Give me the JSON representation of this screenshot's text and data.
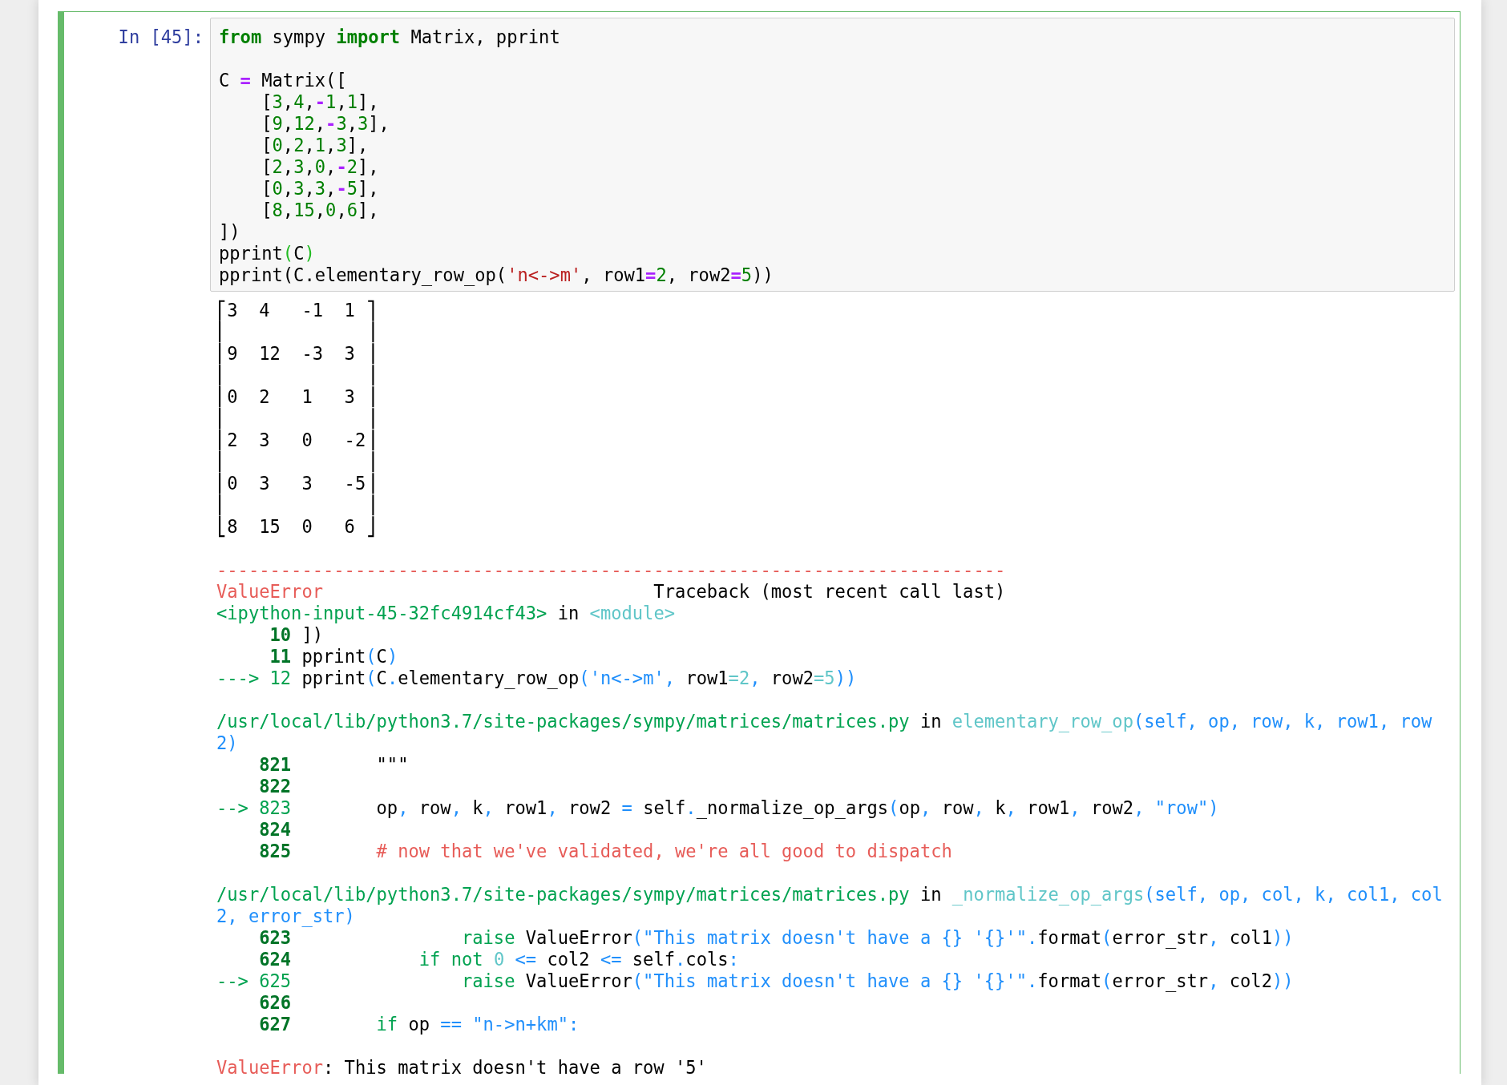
{
  "cell": {
    "prompt": "In [45]:",
    "selected": true,
    "input": [
      {
        "tokens": [
          {
            "text": "from",
            "kind": "kw"
          },
          {
            "text": " sympy ",
            "kind": "plain"
          },
          {
            "text": "import",
            "kind": "kw"
          },
          {
            "text": " Matrix, pprint",
            "kind": "plain"
          }
        ]
      },
      {
        "gap_before": true,
        "tokens": [
          {
            "text": "C ",
            "kind": "plain"
          },
          {
            "text": "=",
            "kind": "op"
          },
          {
            "text": " Matrix([",
            "kind": "plain"
          }
        ]
      },
      {
        "tokens": [
          {
            "text": "    [",
            "kind": "plain"
          },
          {
            "text": "3",
            "kind": "num"
          },
          {
            "text": ",",
            "kind": "plain"
          },
          {
            "text": "4",
            "kind": "num"
          },
          {
            "text": ",",
            "kind": "plain"
          },
          {
            "text": "-",
            "kind": "op"
          },
          {
            "text": "1",
            "kind": "num"
          },
          {
            "text": ",",
            "kind": "plain"
          },
          {
            "text": "1",
            "kind": "num"
          },
          {
            "text": "],",
            "kind": "plain"
          }
        ]
      },
      {
        "tokens": [
          {
            "text": "    [",
            "kind": "plain"
          },
          {
            "text": "9",
            "kind": "num"
          },
          {
            "text": ",",
            "kind": "plain"
          },
          {
            "text": "12",
            "kind": "num"
          },
          {
            "text": ",",
            "kind": "plain"
          },
          {
            "text": "-",
            "kind": "op"
          },
          {
            "text": "3",
            "kind": "num"
          },
          {
            "text": ",",
            "kind": "plain"
          },
          {
            "text": "3",
            "kind": "num"
          },
          {
            "text": "],",
            "kind": "plain"
          }
        ]
      },
      {
        "tokens": [
          {
            "text": "    [",
            "kind": "plain"
          },
          {
            "text": "0",
            "kind": "num"
          },
          {
            "text": ",",
            "kind": "plain"
          },
          {
            "text": "2",
            "kind": "num"
          },
          {
            "text": ",",
            "kind": "plain"
          },
          {
            "text": "1",
            "kind": "num"
          },
          {
            "text": ",",
            "kind": "plain"
          },
          {
            "text": "3",
            "kind": "num"
          },
          {
            "text": "],",
            "kind": "plain"
          }
        ]
      },
      {
        "tokens": [
          {
            "text": "    [",
            "kind": "plain"
          },
          {
            "text": "2",
            "kind": "num"
          },
          {
            "text": ",",
            "kind": "plain"
          },
          {
            "text": "3",
            "kind": "num"
          },
          {
            "text": ",",
            "kind": "plain"
          },
          {
            "text": "0",
            "kind": "num"
          },
          {
            "text": ",",
            "kind": "plain"
          },
          {
            "text": "-",
            "kind": "op"
          },
          {
            "text": "2",
            "kind": "num"
          },
          {
            "text": "],",
            "kind": "plain"
          }
        ]
      },
      {
        "tokens": [
          {
            "text": "    [",
            "kind": "plain"
          },
          {
            "text": "0",
            "kind": "num"
          },
          {
            "text": ",",
            "kind": "plain"
          },
          {
            "text": "3",
            "kind": "num"
          },
          {
            "text": ",",
            "kind": "plain"
          },
          {
            "text": "3",
            "kind": "num"
          },
          {
            "text": ",",
            "kind": "plain"
          },
          {
            "text": "-",
            "kind": "op"
          },
          {
            "text": "5",
            "kind": "num"
          },
          {
            "text": "],",
            "kind": "plain"
          }
        ]
      },
      {
        "tokens": [
          {
            "text": "    [",
            "kind": "plain"
          },
          {
            "text": "8",
            "kind": "num"
          },
          {
            "text": ",",
            "kind": "plain"
          },
          {
            "text": "15",
            "kind": "num"
          },
          {
            "text": ",",
            "kind": "plain"
          },
          {
            "text": "0",
            "kind": "num"
          },
          {
            "text": ",",
            "kind": "plain"
          },
          {
            "text": "6",
            "kind": "num"
          },
          {
            "text": "],",
            "kind": "plain"
          }
        ]
      },
      {
        "tokens": [
          {
            "text": "])",
            "kind": "plain"
          }
        ]
      },
      {
        "tokens": [
          {
            "text": "pprint",
            "kind": "plain"
          },
          {
            "text": "(",
            "kind": "match"
          },
          {
            "text": "C",
            "kind": "plain"
          },
          {
            "text": ")",
            "kind": "match"
          }
        ]
      },
      {
        "tokens": [
          {
            "text": "pprint(C.elementary_row_op(",
            "kind": "plain"
          },
          {
            "text": "'n<->m'",
            "kind": "str"
          },
          {
            "text": ", row1",
            "kind": "plain"
          },
          {
            "text": "=",
            "kind": "op"
          },
          {
            "text": "2",
            "kind": "num"
          },
          {
            "text": ", row2",
            "kind": "plain"
          },
          {
            "text": "=",
            "kind": "op"
          },
          {
            "text": "5",
            "kind": "num"
          },
          {
            "text": "))",
            "kind": "plain"
          }
        ]
      }
    ],
    "matrix": [
      "⎡3  4   -1  1 ⎤",
      "⎢             ⎥",
      "⎢9  12  -3  3 ⎥",
      "⎢             ⎥",
      "⎢0  2   1   3 ⎥",
      "⎢             ⎥",
      "⎢2  3   0   -2⎥",
      "⎢             ⎥",
      "⎢0  3   3   -5⎥",
      "⎢             ⎥",
      "⎣8  15  0   6 ⎦"
    ],
    "traceback": [
      {
        "gap_before": true,
        "tokens": [
          {
            "text": "--------------------------------------------------------------------------",
            "kind": "red"
          }
        ]
      },
      {
        "tokens": [
          {
            "text": "ValueError",
            "kind": "red"
          },
          {
            "text": "                               Traceback (most recent call last)",
            "kind": "plain"
          }
        ]
      },
      {
        "tokens": [
          {
            "text": "<ipython-input-45-32fc4914cf43>",
            "kind": "green"
          },
          {
            "text": " in ",
            "kind": "plain"
          },
          {
            "text": "<module>",
            "kind": "cyan"
          }
        ]
      },
      {
        "tokens": [
          {
            "text": "     10",
            "kind": "lineno"
          },
          {
            "text": " ])",
            "kind": "plain"
          }
        ]
      },
      {
        "tokens": [
          {
            "text": "     11",
            "kind": "lineno"
          },
          {
            "text": " pprint",
            "kind": "plain"
          },
          {
            "text": "(",
            "kind": "blue"
          },
          {
            "text": "C",
            "kind": "plain"
          },
          {
            "text": ")",
            "kind": "blue"
          }
        ]
      },
      {
        "tokens": [
          {
            "text": "---> 12",
            "kind": "green"
          },
          {
            "text": " pprint",
            "kind": "plain"
          },
          {
            "text": "(",
            "kind": "blue"
          },
          {
            "text": "C",
            "kind": "plain"
          },
          {
            "text": ".",
            "kind": "blue"
          },
          {
            "text": "elementary_row_op",
            "kind": "plain"
          },
          {
            "text": "(",
            "kind": "blue"
          },
          {
            "text": "'n<->m'",
            "kind": "blue"
          },
          {
            "text": ", ",
            "kind": "blue"
          },
          {
            "text": "row1",
            "kind": "plain"
          },
          {
            "text": "=2",
            "kind": "cyan"
          },
          {
            "text": ", ",
            "kind": "blue"
          },
          {
            "text": "row2",
            "kind": "plain"
          },
          {
            "text": "=5",
            "kind": "cyan"
          },
          {
            "text": "))",
            "kind": "blue"
          }
        ]
      },
      {
        "gap_before": true,
        "tokens": [
          {
            "text": "/usr/local/lib/python3.7/site-packages/sympy/matrices/matrices.py",
            "kind": "green"
          },
          {
            "text": " in ",
            "kind": "plain"
          },
          {
            "text": "elementary_row_op",
            "kind": "cyan"
          },
          {
            "text": "(self, op, row, k, row1, row",
            "kind": "blue"
          }
        ]
      },
      {
        "tokens": [
          {
            "text": "2)",
            "kind": "blue"
          }
        ]
      },
      {
        "tokens": [
          {
            "text": "    821",
            "kind": "lineno"
          },
          {
            "text": "        \"\"\"",
            "kind": "plain"
          }
        ]
      },
      {
        "tokens": [
          {
            "text": "    822",
            "kind": "lineno"
          }
        ]
      },
      {
        "tokens": [
          {
            "text": "--> 823",
            "kind": "green"
          },
          {
            "text": "        op",
            "kind": "plain"
          },
          {
            "text": ", ",
            "kind": "blue"
          },
          {
            "text": "row",
            "kind": "plain"
          },
          {
            "text": ", ",
            "kind": "blue"
          },
          {
            "text": "k",
            "kind": "plain"
          },
          {
            "text": ", ",
            "kind": "blue"
          },
          {
            "text": "row1",
            "kind": "plain"
          },
          {
            "text": ", ",
            "kind": "blue"
          },
          {
            "text": "row2 ",
            "kind": "plain"
          },
          {
            "text": "=",
            "kind": "blue"
          },
          {
            "text": " self",
            "kind": "plain"
          },
          {
            "text": ".",
            "kind": "blue"
          },
          {
            "text": "_normalize_op_args",
            "kind": "plain"
          },
          {
            "text": "(",
            "kind": "blue"
          },
          {
            "text": "op",
            "kind": "plain"
          },
          {
            "text": ", ",
            "kind": "blue"
          },
          {
            "text": "row",
            "kind": "plain"
          },
          {
            "text": ", ",
            "kind": "blue"
          },
          {
            "text": "k",
            "kind": "plain"
          },
          {
            "text": ", ",
            "kind": "blue"
          },
          {
            "text": "row1",
            "kind": "plain"
          },
          {
            "text": ", ",
            "kind": "blue"
          },
          {
            "text": "row2",
            "kind": "plain"
          },
          {
            "text": ", ",
            "kind": "blue"
          },
          {
            "text": "\"row\"",
            "kind": "blue"
          },
          {
            "text": ")",
            "kind": "blue"
          }
        ]
      },
      {
        "tokens": [
          {
            "text": "    824",
            "kind": "lineno"
          }
        ]
      },
      {
        "tokens": [
          {
            "text": "    825",
            "kind": "lineno"
          },
          {
            "text": "        # now that we've validated, we're all good to dispatch",
            "kind": "red"
          }
        ]
      },
      {
        "gap_before": true,
        "tokens": [
          {
            "text": "/usr/local/lib/python3.7/site-packages/sympy/matrices/matrices.py",
            "kind": "green"
          },
          {
            "text": " in ",
            "kind": "plain"
          },
          {
            "text": "_normalize_op_args",
            "kind": "cyan"
          },
          {
            "text": "(self, op, col, k, col1, col",
            "kind": "blue"
          }
        ]
      },
      {
        "tokens": [
          {
            "text": "2, error_str)",
            "kind": "blue"
          }
        ]
      },
      {
        "tokens": [
          {
            "text": "    623",
            "kind": "lineno"
          },
          {
            "text": "                raise",
            "kind": "green"
          },
          {
            "text": " ValueError",
            "kind": "plain"
          },
          {
            "text": "(",
            "kind": "blue"
          },
          {
            "text": "\"This matrix doesn't have a {} '{}'\"",
            "kind": "blue"
          },
          {
            "text": ".",
            "kind": "blue"
          },
          {
            "text": "format",
            "kind": "plain"
          },
          {
            "text": "(",
            "kind": "blue"
          },
          {
            "text": "error_str",
            "kind": "plain"
          },
          {
            "text": ", ",
            "kind": "blue"
          },
          {
            "text": "col1",
            "kind": "plain"
          },
          {
            "text": "))",
            "kind": "blue"
          }
        ]
      },
      {
        "tokens": [
          {
            "text": "    624",
            "kind": "lineno"
          },
          {
            "text": "            if",
            "kind": "green"
          },
          {
            "text": " not",
            "kind": "green"
          },
          {
            "text": " 0",
            "kind": "cyan"
          },
          {
            "text": " <=",
            "kind": "blue"
          },
          {
            "text": " col2 ",
            "kind": "plain"
          },
          {
            "text": "<=",
            "kind": "blue"
          },
          {
            "text": " self",
            "kind": "plain"
          },
          {
            "text": ".",
            "kind": "blue"
          },
          {
            "text": "cols",
            "kind": "plain"
          },
          {
            "text": ":",
            "kind": "blue"
          }
        ]
      },
      {
        "tokens": [
          {
            "text": "--> 625",
            "kind": "green"
          },
          {
            "text": "                raise",
            "kind": "green"
          },
          {
            "text": " ValueError",
            "kind": "plain"
          },
          {
            "text": "(",
            "kind": "blue"
          },
          {
            "text": "\"This matrix doesn't have a {} '{}'\"",
            "kind": "blue"
          },
          {
            "text": ".",
            "kind": "blue"
          },
          {
            "text": "format",
            "kind": "plain"
          },
          {
            "text": "(",
            "kind": "blue"
          },
          {
            "text": "error_str",
            "kind": "plain"
          },
          {
            "text": ", ",
            "kind": "blue"
          },
          {
            "text": "col2",
            "kind": "plain"
          },
          {
            "text": "))",
            "kind": "blue"
          }
        ]
      },
      {
        "tokens": [
          {
            "text": "    626",
            "kind": "lineno"
          }
        ]
      },
      {
        "tokens": [
          {
            "text": "    627",
            "kind": "lineno"
          },
          {
            "text": "        if",
            "kind": "green"
          },
          {
            "text": " op ",
            "kind": "plain"
          },
          {
            "text": "==",
            "kind": "blue"
          },
          {
            "text": " \"n->n+km\"",
            "kind": "blue"
          },
          {
            "text": ":",
            "kind": "blue"
          }
        ]
      },
      {
        "gap_before": true,
        "tokens": [
          {
            "text": "ValueError",
            "kind": "red"
          },
          {
            "text": ": This matrix doesn't have a row '5'",
            "kind": "plain"
          }
        ]
      }
    ]
  }
}
